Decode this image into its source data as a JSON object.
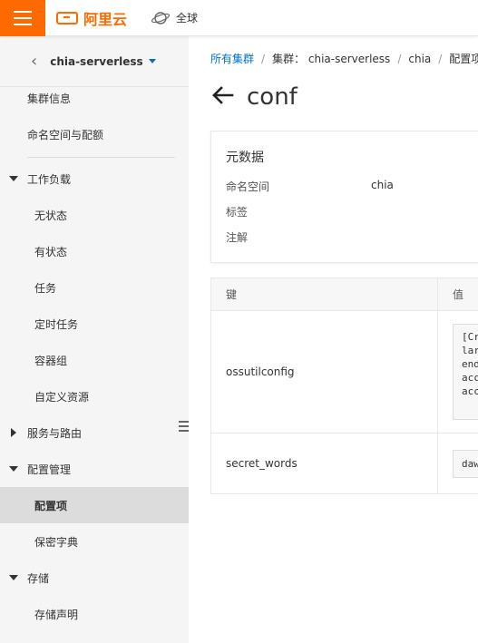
{
  "topbar": {
    "brand": "阿里云",
    "region_label": "全球"
  },
  "sidebar": {
    "cluster_name": "chia-serverless",
    "items": [
      {
        "label": "集群信息"
      },
      {
        "label": "命名空间与配额"
      },
      {
        "label": "工作负载"
      },
      {
        "label": "无状态"
      },
      {
        "label": "有状态"
      },
      {
        "label": "任务"
      },
      {
        "label": "定时任务"
      },
      {
        "label": "容器组"
      },
      {
        "label": "自定义资源"
      },
      {
        "label": "服务与路由"
      },
      {
        "label": "配置管理"
      },
      {
        "label": "配置项"
      },
      {
        "label": "保密字典"
      },
      {
        "label": "存储"
      },
      {
        "label": "存储声明"
      }
    ]
  },
  "breadcrumb": {
    "all_clusters": "所有集群",
    "cluster": "集群： chia-serverless",
    "namespace": "chia",
    "current": "配置项"
  },
  "page": {
    "title": "conf"
  },
  "metadata": {
    "title": "元数据",
    "namespace_label": "命名空间",
    "namespace_value": "chia",
    "labels_label": "标签",
    "annotations_label": "注解"
  },
  "table": {
    "key_header": "键",
    "value_header": "值",
    "rows": [
      {
        "key": "ossutilconfig",
        "value": "[Cr\nlar\nend\nacc\nacc"
      },
      {
        "key": "secret_words",
        "value": "daw"
      }
    ]
  }
}
